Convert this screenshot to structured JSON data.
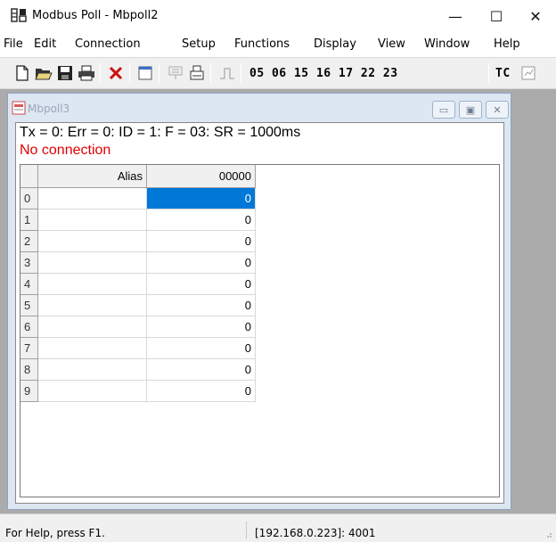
{
  "window": {
    "title": "Modbus Poll - Mbpoll2",
    "controls": {
      "minimize": "—",
      "maximize": "☐",
      "close": "✕"
    }
  },
  "menu": [
    "File",
    "Edit",
    "Connection",
    "Setup",
    "Functions",
    "Display",
    "View",
    "Window",
    "Help"
  ],
  "toolbar": {
    "icons": [
      "new-icon",
      "open-icon",
      "save-icon",
      "print-icon",
      "delete-icon",
      "window-icon",
      "read-write-icon",
      "print-preview-icon",
      "pulse-icon"
    ],
    "function_codes": "05 06 15 16 17 22 23",
    "tc_label": "TC"
  },
  "child": {
    "title": "Mbpoll3",
    "status_line": "Tx = 0: Err = 0: ID = 1: F = 03: SR = 1000ms",
    "connection": "No connection",
    "connection_color": "#e00000",
    "grid": {
      "headers": {
        "alias": "Alias",
        "value": "00000"
      },
      "rows": [
        {
          "num": "0",
          "alias": "",
          "value": "0"
        },
        {
          "num": "1",
          "alias": "",
          "value": "0"
        },
        {
          "num": "2",
          "alias": "",
          "value": "0"
        },
        {
          "num": "3",
          "alias": "",
          "value": "0"
        },
        {
          "num": "4",
          "alias": "",
          "value": "0"
        },
        {
          "num": "5",
          "alias": "",
          "value": "0"
        },
        {
          "num": "6",
          "alias": "",
          "value": "0"
        },
        {
          "num": "7",
          "alias": "",
          "value": "0"
        },
        {
          "num": "8",
          "alias": "",
          "value": "0"
        },
        {
          "num": "9",
          "alias": "",
          "value": "0"
        }
      ],
      "selected_color": "#0078d7"
    }
  },
  "statusbar": {
    "help": "For Help, press F1.",
    "address": "[192.168.0.223]: 4001"
  }
}
